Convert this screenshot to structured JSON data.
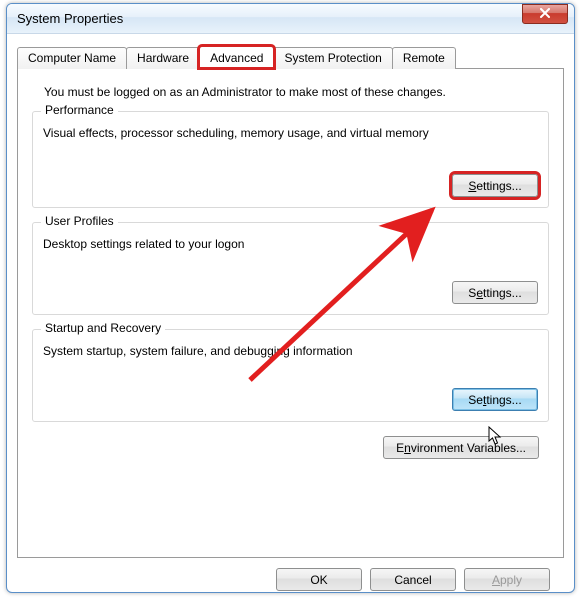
{
  "window": {
    "title": "System Properties"
  },
  "tabs": {
    "computer_name": "Computer Name",
    "hardware": "Hardware",
    "advanced": "Advanced",
    "system_protection": "System Protection",
    "remote": "Remote"
  },
  "admin_note": "You must be logged on as an Administrator to make most of these changes.",
  "groups": {
    "performance": {
      "title": "Performance",
      "desc": "Visual effects, processor scheduling, memory usage, and virtual memory",
      "settings_label": "Settings..."
    },
    "user_profiles": {
      "title": "User Profiles",
      "desc": "Desktop settings related to your logon",
      "settings_label": "Settings..."
    },
    "startup_recovery": {
      "title": "Startup and Recovery",
      "desc": "System startup, system failure, and debugging information",
      "settings_label": "Settings..."
    }
  },
  "env_button": "Environment Variables...",
  "footer": {
    "ok": "OK",
    "cancel": "Cancel",
    "apply": "Apply"
  },
  "annotation": {
    "highlighted_tab": "advanced",
    "highlighted_button": "performance_settings",
    "arrow_color": "#e21f1f"
  }
}
